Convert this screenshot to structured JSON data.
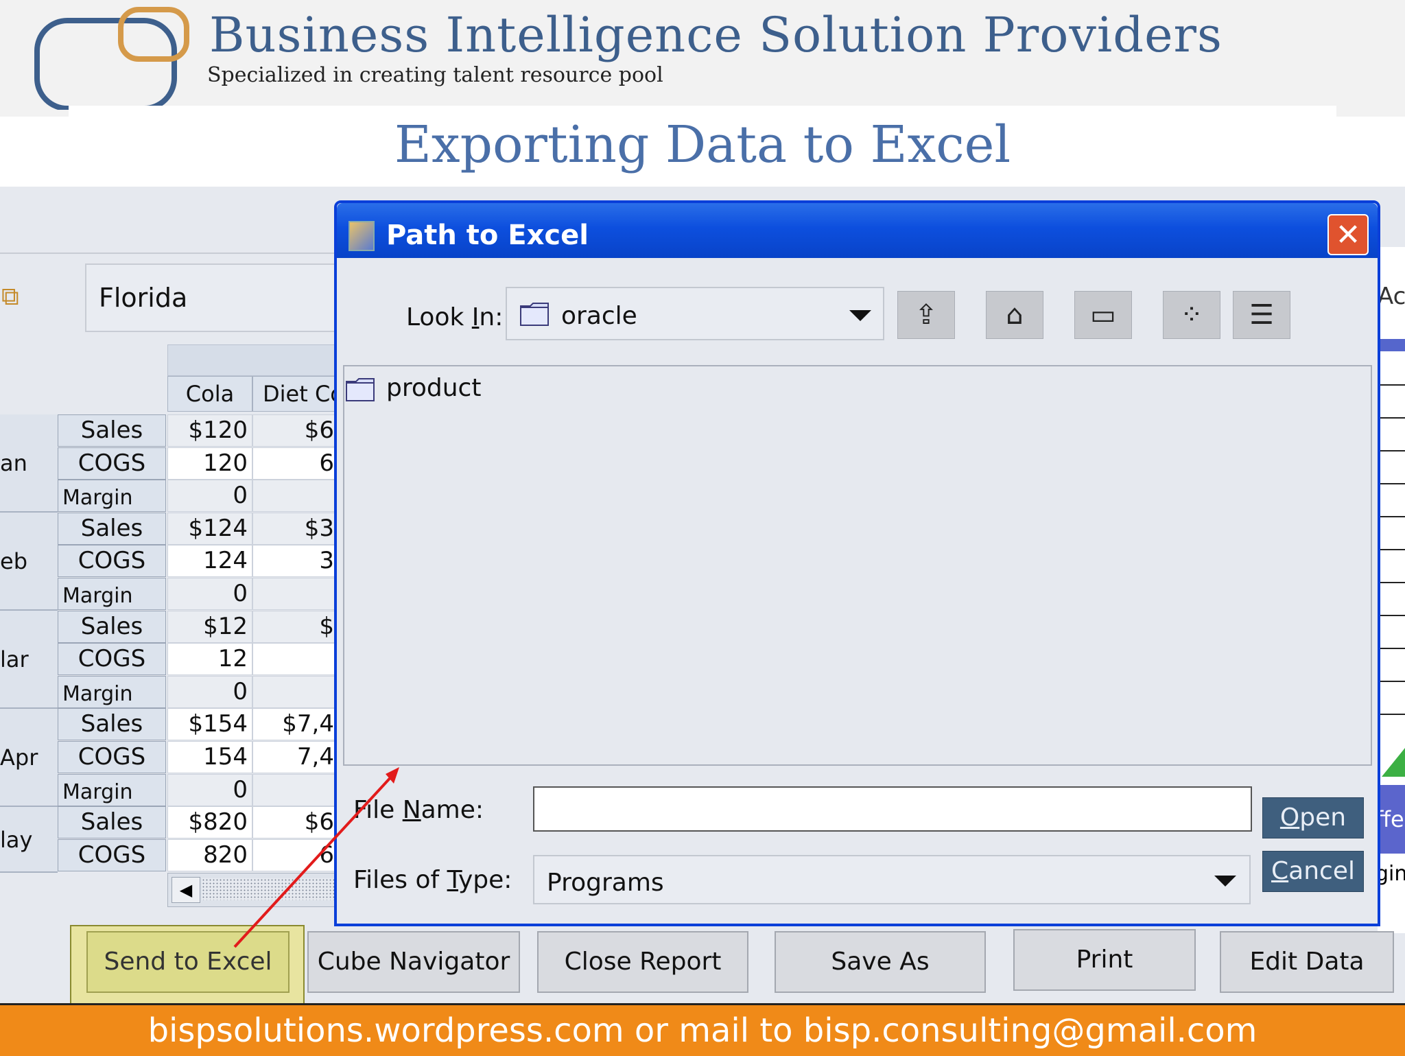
{
  "header": {
    "company": "Business Intelligence Solution Providers",
    "tagline": "Specialized in creating talent resource pool",
    "slide_title": "Exporting Data to Excel"
  },
  "report": {
    "pov_value": "Florida",
    "columns": [
      "Cola",
      "Diet Co"
    ],
    "months": [
      "an",
      "eb",
      "lar",
      "Apr",
      "lay"
    ],
    "rows": [
      {
        "measure": "Sales",
        "cola": "$120",
        "diet": "$6"
      },
      {
        "measure": "COGS",
        "cola": "120",
        "diet": "6"
      },
      {
        "measure": "Margin",
        "cola": "0",
        "diet": ""
      },
      {
        "measure": "Sales",
        "cola": "$124",
        "diet": "$3"
      },
      {
        "measure": "COGS",
        "cola": "124",
        "diet": "3"
      },
      {
        "measure": "Margin",
        "cola": "0",
        "diet": ""
      },
      {
        "measure": "Sales",
        "cola": "$12",
        "diet": "$"
      },
      {
        "measure": "COGS",
        "cola": "12",
        "diet": ""
      },
      {
        "measure": "Margin",
        "cola": "0",
        "diet": ""
      },
      {
        "measure": "Sales",
        "cola": "$154",
        "diet": "$7,4"
      },
      {
        "measure": "COGS",
        "cola": "154",
        "diet": "7,4"
      },
      {
        "measure": "Margin",
        "cola": "0",
        "diet": ""
      },
      {
        "measure": "Sales",
        "cola": "$820",
        "diet": "$6"
      },
      {
        "measure": "COGS",
        "cola": "820",
        "diet": "6"
      }
    ],
    "right_partial": {
      "top": "Ac",
      "mid": "ffe",
      "low": "gin"
    }
  },
  "dialog": {
    "title": "Path to Excel",
    "look_in_label_pre": "Look ",
    "look_in_label_ul": "I",
    "look_in_label_post": "n:",
    "look_in_value": "oracle",
    "tool_icons": [
      "up-folder-icon",
      "home-icon",
      "new-folder-icon",
      "list-view-icon",
      "details-view-icon"
    ],
    "list_items": [
      "product"
    ],
    "file_name_label_pre": "File ",
    "file_name_label_ul": "N",
    "file_name_label_post": "ame:",
    "file_name_value": "",
    "files_of_type_label_pre": "Files of ",
    "files_of_type_label_ul": "T",
    "files_of_type_label_post": "ype:",
    "files_of_type_value": "Programs",
    "open_ul": "O",
    "open_rest": "pen",
    "cancel_ul": "C",
    "cancel_rest": "ancel"
  },
  "buttons": {
    "send_to_excel": "Send to Excel",
    "cube_navigator": "Cube Navigator",
    "close_report": "Close Report",
    "save_as": "Save As",
    "print": "Print",
    "edit_data": "Edit Data"
  },
  "footer": {
    "text": "bispsolutions.wordpress.com or mail to bisp.consulting@gmail.com"
  },
  "colors": {
    "title_blue": "#4a6fa8",
    "dialog_blue": "#0a3fd9",
    "footer_orange": "#f08a18",
    "highlight_yellow": "#e8e4a0",
    "arrow_red": "#e21b1b"
  }
}
